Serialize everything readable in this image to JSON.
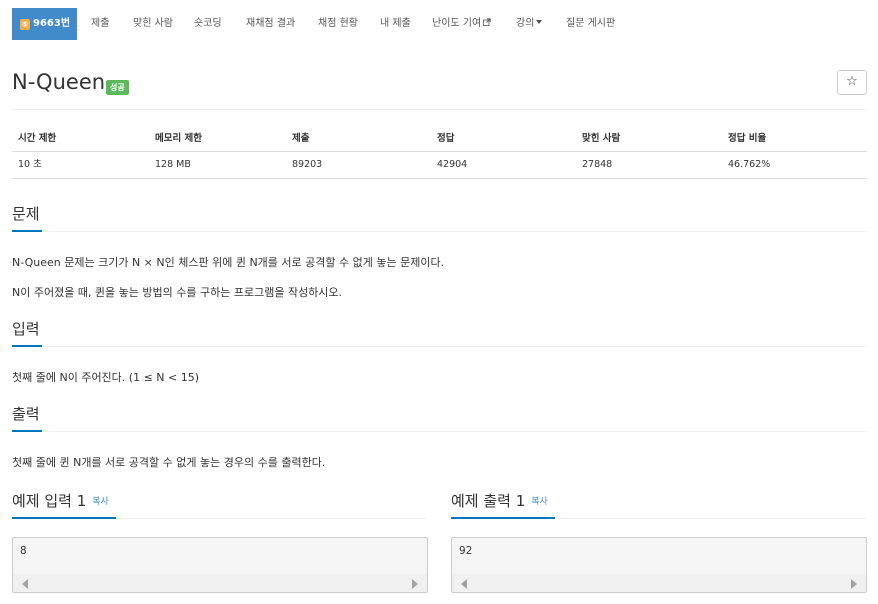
{
  "nav": {
    "problem_badge": "9663번",
    "items": [
      "제출",
      "맞힌 사람",
      "숏코딩",
      "재채점 결과",
      "채점 현황",
      "내 제출",
      "난이도 기여",
      "강의",
      "질문 게시판"
    ]
  },
  "problem": {
    "title": "N-Queen",
    "status": "성공",
    "star": "☆"
  },
  "info": {
    "headers": [
      "시간 제한",
      "메모리 제한",
      "제출",
      "정답",
      "맞힌 사람",
      "정답 비율"
    ],
    "values": [
      "10 초",
      "128 MB",
      "89203",
      "42904",
      "27848",
      "46.762%"
    ]
  },
  "sections": {
    "description": {
      "title": "문제",
      "lines": [
        "N-Queen 문제는 크기가 N × N인 체스판 위에 퀸 N개를 서로 공격할 수 없게 놓는 문제이다.",
        "N이 주어졌을 때, 퀸을 놓는 방법의 수를 구하는 프로그램을 작성하시오."
      ]
    },
    "input": {
      "title": "입력",
      "text": "첫째 줄에 N이 주어진다. (1 ≤ N < 15)"
    },
    "output": {
      "title": "출력",
      "text": "첫째 줄에 퀸 N개를 서로 공격할 수 없게 놓는 경우의 수를 출력한다."
    }
  },
  "samples": {
    "input": {
      "title": "예제 입력 1",
      "copy": "복사",
      "value": "8"
    },
    "output": {
      "title": "예제 출력 1",
      "copy": "복사",
      "value": "92"
    }
  },
  "colors": {
    "nav_active": "#428bca",
    "status_badge": "#5cb85c",
    "section_accent": "#0076c0",
    "link": "#428bca"
  }
}
